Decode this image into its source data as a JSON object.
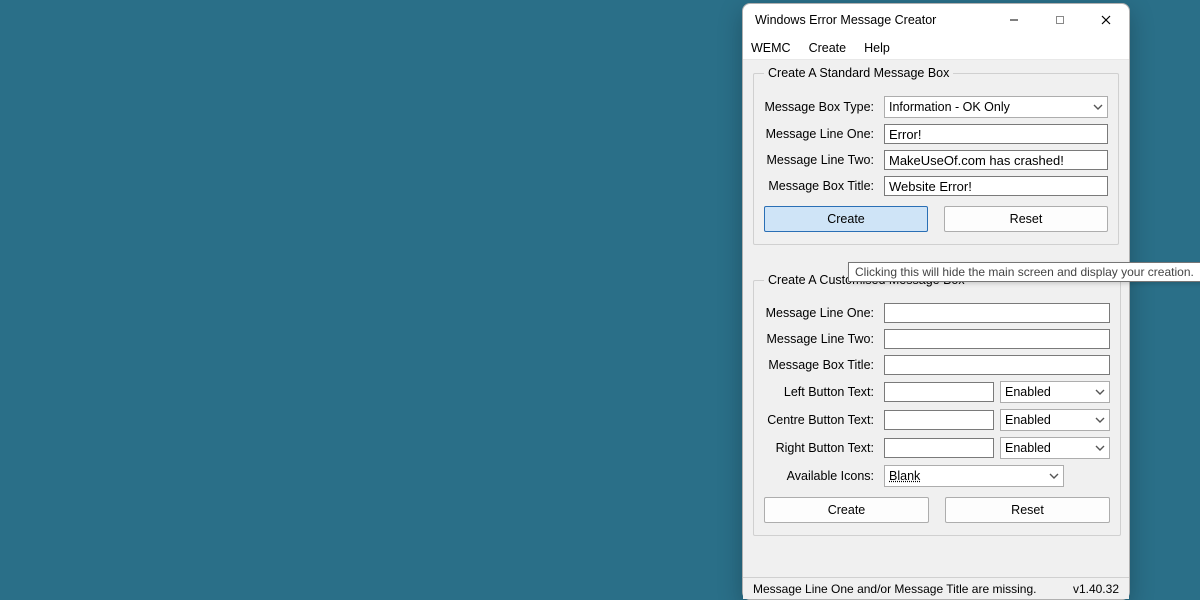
{
  "window": {
    "title": "Windows Error Message Creator"
  },
  "menu": {
    "wemc": "WEMC",
    "create": "Create",
    "help": "Help"
  },
  "standard": {
    "legend": "Create A Standard Message Box",
    "type_label": "Message Box Type:",
    "type_value": "Information - OK Only",
    "line1_label": "Message Line One:",
    "line1_value": "Error!",
    "line2_label": "Message Line Two:",
    "line2_value": "MakeUseOf.com has crashed!",
    "title_label": "Message Box Title:",
    "title_value": "Website Error!",
    "create_btn": "Create",
    "reset_btn": "Reset"
  },
  "custom": {
    "legend": "Create A Customised Message Box",
    "line1_label": "Message Line One:",
    "line1_value": "",
    "line2_label": "Message Line Two:",
    "line2_value": "",
    "title_label": "Message Box Title:",
    "title_value": "",
    "left_label": "Left Button Text:",
    "left_value": "",
    "left_state": "Enabled",
    "centre_label": "Centre Button Text:",
    "centre_value": "",
    "centre_state": "Enabled",
    "right_label": "Right Button Text:",
    "right_value": "",
    "right_state": "Enabled",
    "icons_label": "Available Icons:",
    "icons_value": "Blank",
    "create_btn": "Create",
    "reset_btn": "Reset"
  },
  "tooltip": "Clicking this will hide the main screen and display your creation.",
  "status": {
    "message": "Message Line One and/or Message Title are missing.",
    "version": "v1.40.32"
  }
}
